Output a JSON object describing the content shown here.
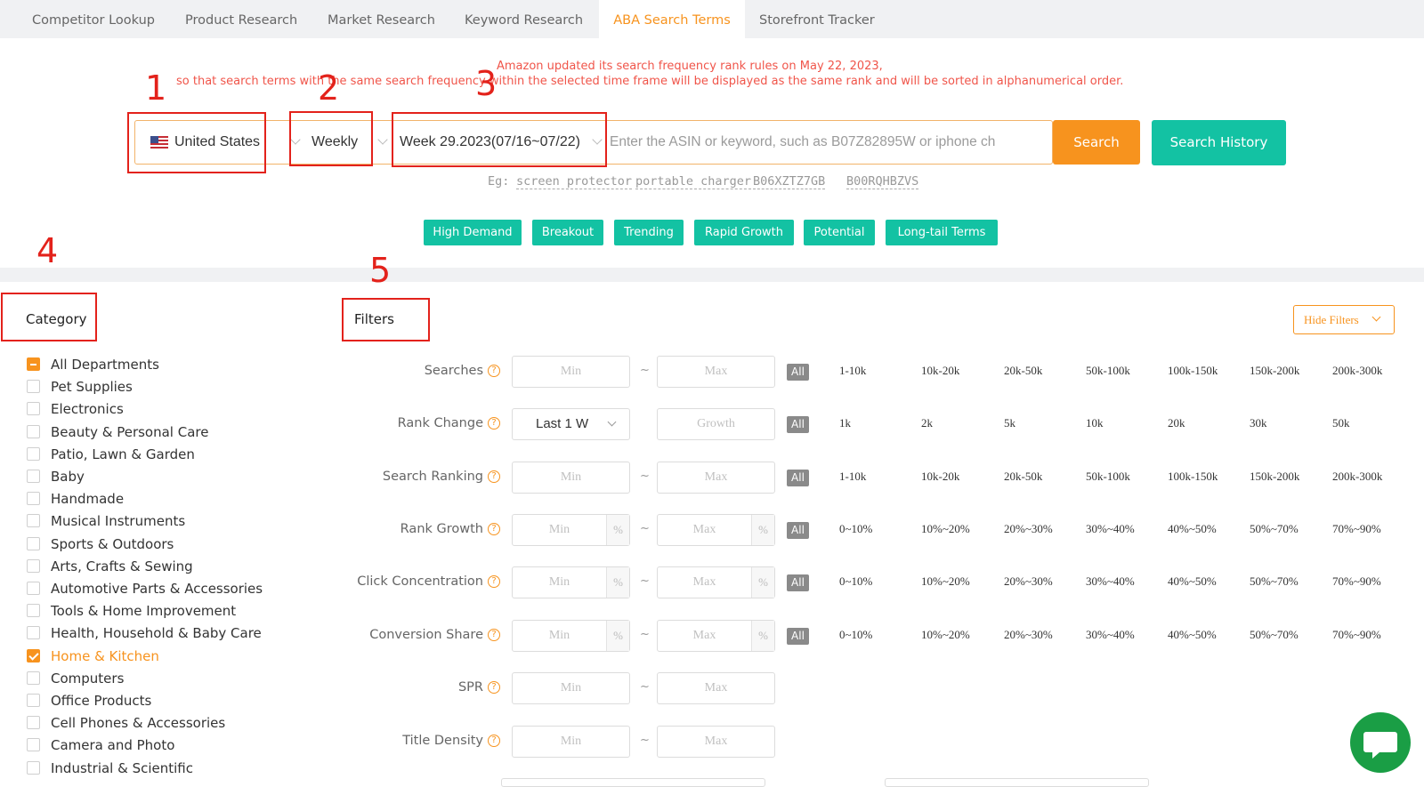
{
  "tabs": [
    {
      "label": "Competitor Lookup",
      "active": false
    },
    {
      "label": "Product Research",
      "active": false
    },
    {
      "label": "Market Research",
      "active": false
    },
    {
      "label": "Keyword Research",
      "active": false
    },
    {
      "label": "ABA Search Terms",
      "active": true
    },
    {
      "label": "Storefront Tracker",
      "active": false
    }
  ],
  "notice": {
    "line1": "Amazon updated its search frequency rank rules on May 22, 2023,",
    "line2": "so that search terms with the same search frequency within the selected time frame will be displayed as the same rank and will be sorted in alphanumerical order."
  },
  "annotations": [
    "1",
    "2",
    "3",
    "4",
    "5"
  ],
  "search": {
    "country": "United States",
    "period": "Weekly",
    "week": "Week 29.2023(07/16~07/22)",
    "placeholder": "Enter the ASIN or keyword, such as B07Z82895W or iphone ch",
    "search_label": "Search",
    "history_label": "Search History"
  },
  "examples": {
    "prefix": "Eg:",
    "items": [
      "screen protector",
      "portable charger",
      "B06XZTZ7GB",
      "B00RQHBZVS"
    ]
  },
  "tags": [
    "High Demand",
    "Breakout",
    "Trending",
    "Rapid Growth",
    "Potential",
    "Long-tail Terms"
  ],
  "category": {
    "title": "Category",
    "items": [
      {
        "label": "All Departments",
        "state": "indeterminate"
      },
      {
        "label": "Pet Supplies",
        "state": "unchecked"
      },
      {
        "label": "Electronics",
        "state": "unchecked"
      },
      {
        "label": "Beauty & Personal Care",
        "state": "unchecked"
      },
      {
        "label": "Patio, Lawn & Garden",
        "state": "unchecked"
      },
      {
        "label": "Baby",
        "state": "unchecked"
      },
      {
        "label": "Handmade",
        "state": "unchecked"
      },
      {
        "label": "Musical Instruments",
        "state": "unchecked"
      },
      {
        "label": "Sports & Outdoors",
        "state": "unchecked"
      },
      {
        "label": "Arts, Crafts & Sewing",
        "state": "unchecked"
      },
      {
        "label": "Automotive Parts & Accessories",
        "state": "unchecked"
      },
      {
        "label": "Tools & Home Improvement",
        "state": "unchecked"
      },
      {
        "label": "Health, Household & Baby Care",
        "state": "unchecked"
      },
      {
        "label": "Home & Kitchen",
        "state": "checked"
      },
      {
        "label": "Computers",
        "state": "unchecked"
      },
      {
        "label": "Office Products",
        "state": "unchecked"
      },
      {
        "label": "Cell Phones & Accessories",
        "state": "unchecked"
      },
      {
        "label": "Camera and Photo",
        "state": "unchecked"
      },
      {
        "label": "Industrial & Scientific",
        "state": "unchecked"
      }
    ]
  },
  "filters": {
    "title": "Filters",
    "hide_label": "Hide Filters",
    "all_label": "All",
    "tilde": "~",
    "pct": "%",
    "rows": [
      {
        "label": "Searches",
        "min": "Min",
        "max": "Max",
        "pct": false,
        "presets": [
          "1-10k",
          "10k-20k",
          "20k-50k",
          "50k-100k",
          "100k-150k",
          "150k-200k",
          "200k-300k"
        ]
      },
      {
        "label": "Rank Change",
        "select": "Last 1 W",
        "max": "Growth",
        "pct": false,
        "presets": [
          "1k",
          "2k",
          "5k",
          "10k",
          "20k",
          "30k",
          "50k"
        ]
      },
      {
        "label": "Search Ranking",
        "min": "Min",
        "max": "Max",
        "pct": false,
        "presets": [
          "1-10k",
          "10k-20k",
          "20k-50k",
          "50k-100k",
          "100k-150k",
          "150k-200k",
          "200k-300k"
        ]
      },
      {
        "label": "Rank Growth",
        "min": "Min",
        "max": "Max",
        "pct": true,
        "presets": [
          "0~10%",
          "10%~20%",
          "20%~30%",
          "30%~40%",
          "40%~50%",
          "50%~70%",
          "70%~90%"
        ]
      },
      {
        "label": "Click Concentration",
        "min": "Min",
        "max": "Max",
        "pct": true,
        "presets": [
          "0~10%",
          "10%~20%",
          "20%~30%",
          "30%~40%",
          "40%~50%",
          "50%~70%",
          "70%~90%"
        ]
      },
      {
        "label": "Conversion Share",
        "min": "Min",
        "max": "Max",
        "pct": true,
        "presets": [
          "0~10%",
          "10%~20%",
          "20%~30%",
          "30%~40%",
          "40%~50%",
          "50%~70%",
          "70%~90%"
        ]
      },
      {
        "label": "SPR",
        "min": "Min",
        "max": "Max",
        "pct": false,
        "presets": []
      },
      {
        "label": "Title Density",
        "min": "Min",
        "max": "Max",
        "pct": false,
        "presets": []
      }
    ]
  },
  "colors": {
    "accent": "#f7931e",
    "teal": "#13c2a3",
    "annotation": "#e3221b",
    "notice": "#f0554a",
    "chat": "#1a9e45"
  },
  "icons": {
    "flag": "us-flag-icon",
    "help": "question-circle-icon",
    "chat": "chat-bubble-icon"
  }
}
